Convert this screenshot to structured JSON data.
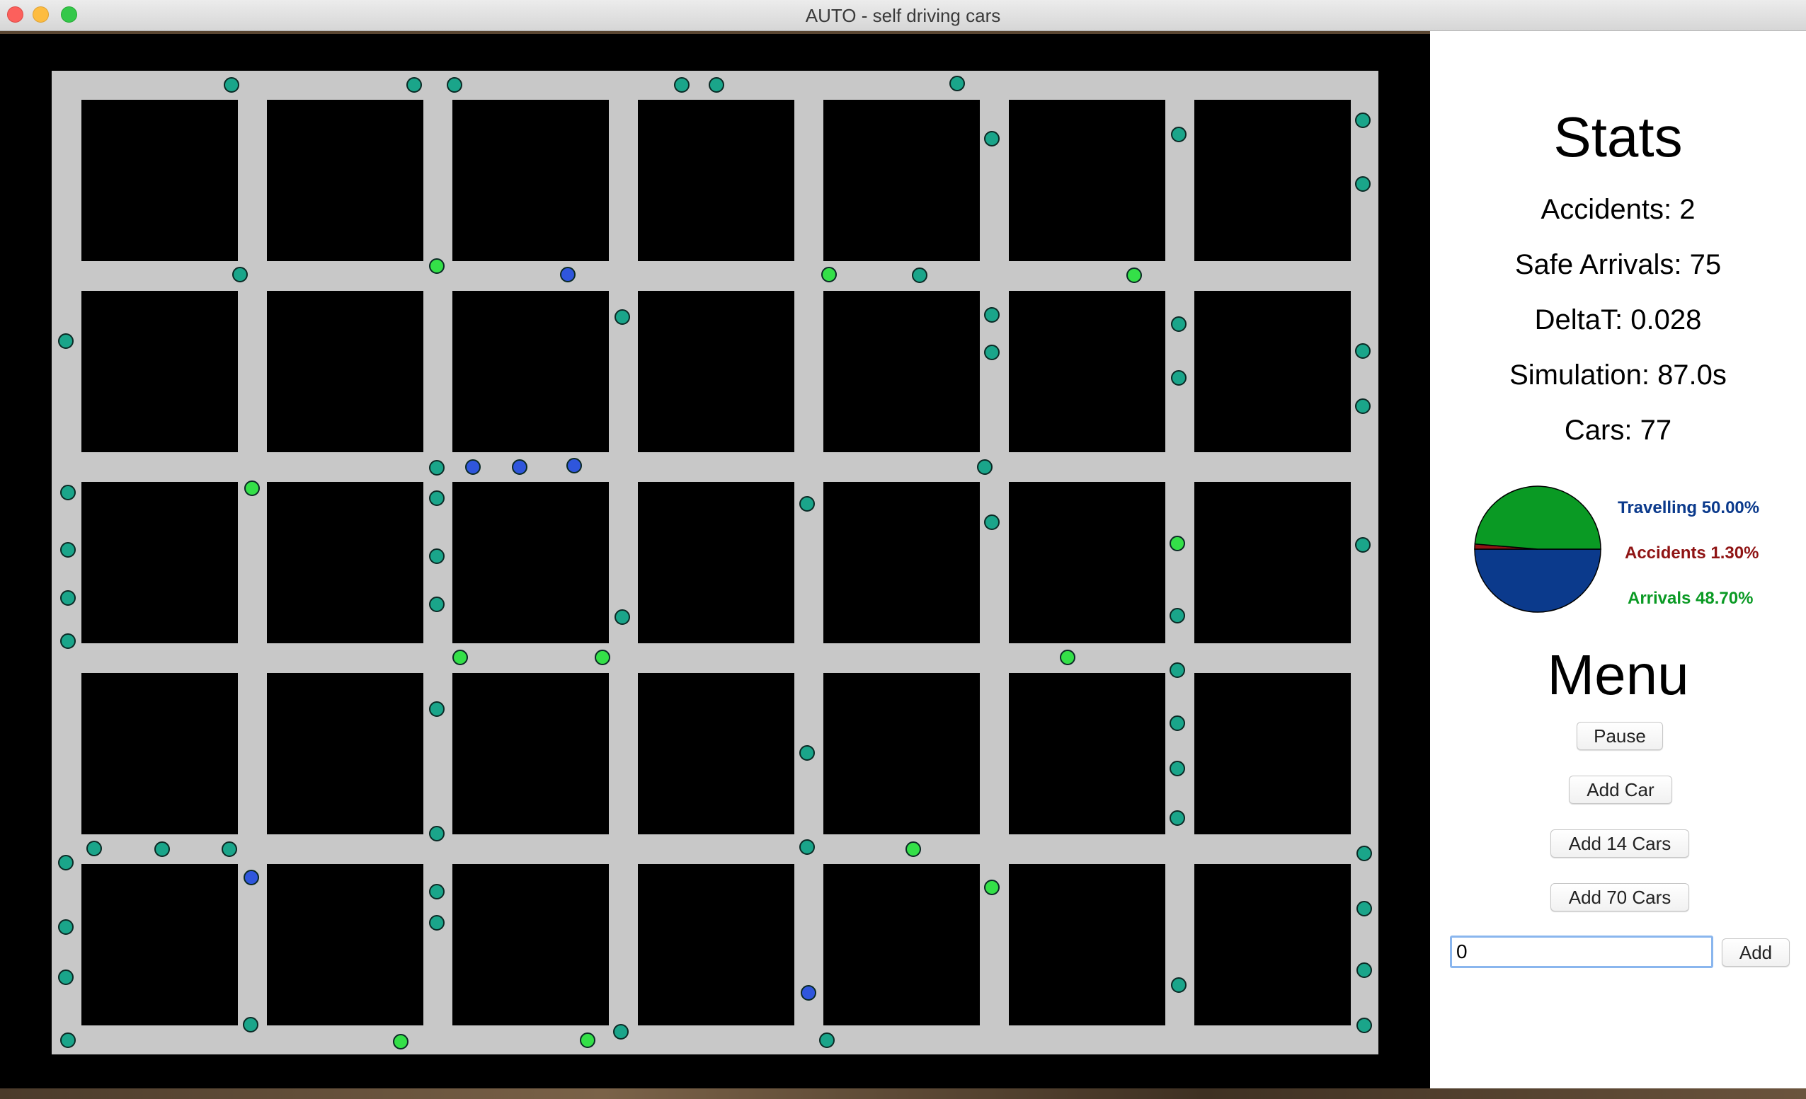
{
  "window": {
    "title": "AUTO - self driving cars"
  },
  "colors": {
    "road": "#c8c8c8",
    "block": "#000000",
    "car_teal": "#1aa58a",
    "car_green": "#34e048",
    "car_blue": "#2f56dc",
    "pie_travelling": "#0b3a8c",
    "pie_accidents": "#8f1414",
    "pie_arrivals": "#0a9a24"
  },
  "simulation": {
    "grid": {
      "columns": 7,
      "rows": 5
    },
    "cars": {
      "count_drawn": 77
    }
  },
  "stats": {
    "heading": "Stats",
    "accidents": "Accidents: 2",
    "safe_arrivals": "Safe Arrivals: 75",
    "delta_t": "DeltaT: 0.028",
    "simulation_time": "Simulation: 87.0s",
    "cars": "Cars: 77"
  },
  "chart_data": {
    "type": "pie",
    "slices": [
      {
        "label": "Travelling",
        "value": 50.0,
        "display": "Travelling 50.00%",
        "color": "#0b3a8c"
      },
      {
        "label": "Accidents",
        "value": 1.3,
        "display": "Accidents 1.30%",
        "color": "#8f1414"
      },
      {
        "label": "Arrivals",
        "value": 48.7,
        "display": "Arrivals 48.70%",
        "color": "#0a9a24"
      }
    ]
  },
  "menu": {
    "heading": "Menu",
    "pause": "Pause",
    "add_car": "Add Car",
    "add_14": "Add 14 Cars",
    "add_70": "Add 70 Cars",
    "input_value": "0",
    "add": "Add"
  }
}
